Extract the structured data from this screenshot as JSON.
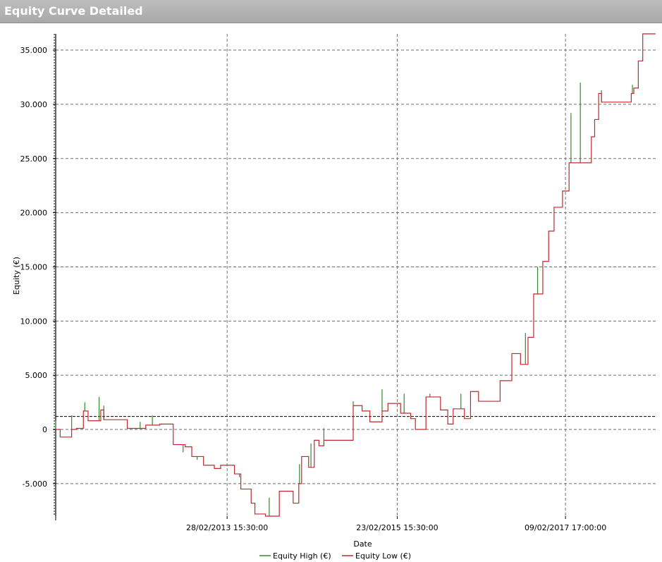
{
  "window": {
    "title": "Equity Curve Detailed"
  },
  "chart_data": {
    "type": "line",
    "title": "",
    "xlabel": "Date",
    "ylabel": "Equity (€)",
    "ylim": [
      -8000,
      36500
    ],
    "yticks": [
      -5000,
      0,
      5000,
      10000,
      15000,
      20000,
      25000,
      30000,
      35000
    ],
    "ytick_labels": [
      "-5.000",
      "0",
      "5.000",
      "10.000",
      "15.000",
      "20.000",
      "25.000",
      "30.000",
      "35.000"
    ],
    "xlim": [
      "2011-03-01",
      "2018-03-01"
    ],
    "xticks": [
      "2013-02-28 15:30:00",
      "2015-02-23 15:30:00",
      "2017-02-09 17:00:00"
    ],
    "xtick_labels": [
      "28/02/2013 15:30:00",
      "23/02/2015 15:30:00",
      "09/02/2017 17:00:00"
    ],
    "reference_line": {
      "y": 1200,
      "style": "dashed"
    },
    "grid": true,
    "legend": "bottom-center",
    "series": [
      {
        "name": "Equity High (€)",
        "color": "#2e8b2e",
        "spikes": [
          {
            "x": "2011-03-01",
            "y": 800
          },
          {
            "x": "2011-05-08",
            "y": 1300
          },
          {
            "x": "2011-07-03",
            "y": 2500
          },
          {
            "x": "2011-09-02",
            "y": 3000
          },
          {
            "x": "2011-09-22",
            "y": 2200
          },
          {
            "x": "2012-02-24",
            "y": 700
          },
          {
            "x": "2012-04-16",
            "y": 1300
          },
          {
            "x": "2012-08-25",
            "y": -2100
          },
          {
            "x": "2012-10-24",
            "y": -2800
          },
          {
            "x": "2013-02-21",
            "y": -3300
          },
          {
            "x": "2013-04-22",
            "y": -4400
          },
          {
            "x": "2013-08-27",
            "y": -6300
          },
          {
            "x": "2014-01-03",
            "y": -3200
          },
          {
            "x": "2014-02-21",
            "y": -1300
          },
          {
            "x": "2014-04-17",
            "y": 100
          },
          {
            "x": "2014-08-20",
            "y": 2600
          },
          {
            "x": "2014-12-21",
            "y": 3700
          },
          {
            "x": "2015-03-25",
            "y": 3300
          },
          {
            "x": "2015-07-13",
            "y": 3300
          },
          {
            "x": "2015-11-22",
            "y": 3300
          },
          {
            "x": "2016-08-23",
            "y": 8900
          },
          {
            "x": "2016-10-14",
            "y": 15000
          },
          {
            "x": "2017-03-05",
            "y": 29200
          },
          {
            "x": "2017-04-14",
            "y": 32000
          },
          {
            "x": "2017-07-13",
            "y": 31300
          },
          {
            "x": "2017-11-22",
            "y": 31800
          }
        ]
      },
      {
        "name": "Equity Low (€)",
        "color": "#c0282d",
        "steps": [
          {
            "x": "2011-03-01",
            "y": 0
          },
          {
            "x": "2011-03-20",
            "y": -700
          },
          {
            "x": "2011-05-08",
            "y": 0
          },
          {
            "x": "2011-05-28",
            "y": 100
          },
          {
            "x": "2011-06-27",
            "y": 1700
          },
          {
            "x": "2011-07-17",
            "y": 800
          },
          {
            "x": "2011-09-09",
            "y": 1800
          },
          {
            "x": "2011-09-22",
            "y": 900
          },
          {
            "x": "2011-11-18",
            "y": 900
          },
          {
            "x": "2011-12-31",
            "y": 100
          },
          {
            "x": "2012-03-19",
            "y": 400
          },
          {
            "x": "2012-05-18",
            "y": 500
          },
          {
            "x": "2012-07-14",
            "y": -1400
          },
          {
            "x": "2012-09-03",
            "y": -1600
          },
          {
            "x": "2012-10-01",
            "y": -2500
          },
          {
            "x": "2012-11-20",
            "y": -3300
          },
          {
            "x": "2013-01-05",
            "y": -3600
          },
          {
            "x": "2013-02-01",
            "y": -3300
          },
          {
            "x": "2013-04-01",
            "y": -4100
          },
          {
            "x": "2013-04-28",
            "y": -5500
          },
          {
            "x": "2013-06-11",
            "y": -6800
          },
          {
            "x": "2013-06-27",
            "y": -7800
          },
          {
            "x": "2013-08-11",
            "y": -8000
          },
          {
            "x": "2013-10-09",
            "y": -5700
          },
          {
            "x": "2013-12-07",
            "y": -6800
          },
          {
            "x": "2013-12-31",
            "y": -5000
          },
          {
            "x": "2014-01-12",
            "y": -2500
          },
          {
            "x": "2014-02-11",
            "y": -3500
          },
          {
            "x": "2014-03-07",
            "y": -1000
          },
          {
            "x": "2014-03-27",
            "y": -1500
          },
          {
            "x": "2014-04-17",
            "y": -1000
          },
          {
            "x": "2014-08-20",
            "y": 2200
          },
          {
            "x": "2014-09-27",
            "y": 1700
          },
          {
            "x": "2014-10-30",
            "y": 700
          },
          {
            "x": "2014-12-21",
            "y": 1700
          },
          {
            "x": "2015-01-15",
            "y": 2400
          },
          {
            "x": "2015-03-10",
            "y": 1500
          },
          {
            "x": "2015-04-22",
            "y": 1000
          },
          {
            "x": "2015-05-12",
            "y": 0
          },
          {
            "x": "2015-06-26",
            "y": 3000
          },
          {
            "x": "2015-08-27",
            "y": 1800
          },
          {
            "x": "2015-09-27",
            "y": 500
          },
          {
            "x": "2015-10-20",
            "y": 1900
          },
          {
            "x": "2015-12-07",
            "y": 1000
          },
          {
            "x": "2016-01-02",
            "y": 3500
          },
          {
            "x": "2016-02-05",
            "y": 2600
          },
          {
            "x": "2016-05-07",
            "y": 4500
          },
          {
            "x": "2016-06-26",
            "y": 7000
          },
          {
            "x": "2016-08-02",
            "y": 6000
          },
          {
            "x": "2016-09-03",
            "y": 8500
          },
          {
            "x": "2016-09-27",
            "y": 12500
          },
          {
            "x": "2016-11-05",
            "y": 15500
          },
          {
            "x": "2016-11-30",
            "y": 18300
          },
          {
            "x": "2016-12-23",
            "y": 20500
          },
          {
            "x": "2017-01-28",
            "y": 22000
          },
          {
            "x": "2017-02-25",
            "y": 24600
          },
          {
            "x": "2017-05-31",
            "y": 27000
          },
          {
            "x": "2017-06-14",
            "y": 28600
          },
          {
            "x": "2017-07-01",
            "y": 31000
          },
          {
            "x": "2017-07-13",
            "y": 30200
          },
          {
            "x": "2017-11-17",
            "y": 31000
          },
          {
            "x": "2017-11-28",
            "y": 31500
          },
          {
            "x": "2017-12-17",
            "y": 34000
          },
          {
            "x": "2018-01-05",
            "y": 36500
          },
          {
            "x": "2018-03-01",
            "y": 36500
          }
        ]
      }
    ]
  }
}
